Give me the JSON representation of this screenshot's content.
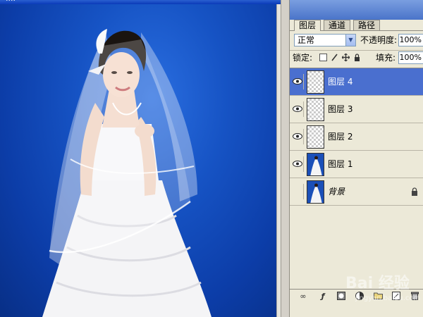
{
  "document": {
    "title": "...."
  },
  "palette": {
    "tabs": [
      "图层",
      "通道",
      "路径"
    ],
    "blend_mode": "正常",
    "opacity_label": "不透明度:",
    "opacity_value": "100%",
    "lock_label": "锁定:",
    "lock_icons": [
      "lock-transparent-icon",
      "lock-paint-icon",
      "lock-move-icon",
      "lock-all-icon"
    ],
    "fill_label": "填充:",
    "fill_value": "100%",
    "layers": [
      {
        "name": "图层 4",
        "visible": true,
        "selected": true,
        "thumbnail": "transparent",
        "locked": false
      },
      {
        "name": "图层 3",
        "visible": true,
        "selected": false,
        "thumbnail": "transparent",
        "locked": false
      },
      {
        "name": "图层 2",
        "visible": true,
        "selected": false,
        "thumbnail": "transparent",
        "locked": false
      },
      {
        "name": "图层 1",
        "visible": true,
        "selected": false,
        "thumbnail": "photo",
        "locked": false
      },
      {
        "name": "背景",
        "visible": false,
        "selected": false,
        "thumbnail": "photo",
        "locked": true
      }
    ],
    "bottom_icons": [
      "link-icon",
      "layer-style-icon",
      "mask-icon",
      "adjustment-icon",
      "folder-icon",
      "new-layer-icon",
      "trash-icon"
    ]
  },
  "watermark": {
    "text": "Bai 经验",
    "url": "jingyan.baidu.com"
  },
  "colors": {
    "canvas_blue": "#1653c4",
    "selected_layer": "#4a6fcf",
    "panel_bg": "#ece9d8"
  }
}
